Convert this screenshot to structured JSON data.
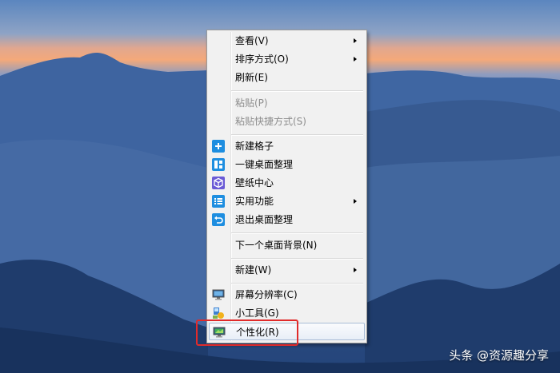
{
  "menu": {
    "items": [
      {
        "label": "查看(V)",
        "has_submenu": true,
        "enabled": true
      },
      {
        "label": "排序方式(O)",
        "has_submenu": true,
        "enabled": true
      },
      {
        "label": "刷新(E)",
        "has_submenu": false,
        "enabled": true
      },
      {
        "label": "粘贴(P)",
        "has_submenu": false,
        "enabled": false
      },
      {
        "label": "粘贴快捷方式(S)",
        "has_submenu": false,
        "enabled": false
      },
      {
        "label": "新建格子",
        "icon": "plus-icon",
        "has_submenu": false,
        "enabled": true
      },
      {
        "label": "一键桌面整理",
        "icon": "layout-grid-icon",
        "has_submenu": false,
        "enabled": true
      },
      {
        "label": "壁纸中心",
        "icon": "cube-icon",
        "has_submenu": false,
        "enabled": true
      },
      {
        "label": "实用功能",
        "icon": "list-icon",
        "has_submenu": true,
        "enabled": true
      },
      {
        "label": "退出桌面整理",
        "icon": "undo-icon",
        "has_submenu": false,
        "enabled": true
      },
      {
        "label": "下一个桌面背景(N)",
        "has_submenu": false,
        "enabled": true
      },
      {
        "label": "新建(W)",
        "has_submenu": true,
        "enabled": true
      },
      {
        "label": "屏幕分辨率(C)",
        "icon": "monitor-icon",
        "has_submenu": false,
        "enabled": true
      },
      {
        "label": "小工具(G)",
        "icon": "gadgets-icon",
        "has_submenu": false,
        "enabled": true
      },
      {
        "label": "个性化(R)",
        "icon": "personalize-icon",
        "has_submenu": false,
        "enabled": true,
        "highlighted": true
      }
    ]
  },
  "watermark": "头条 @资源趣分享",
  "colors": {
    "highlight_box": "#e02b2b",
    "icon_blue": "#1e8ee0",
    "icon_purple": "#6a5ad6"
  }
}
